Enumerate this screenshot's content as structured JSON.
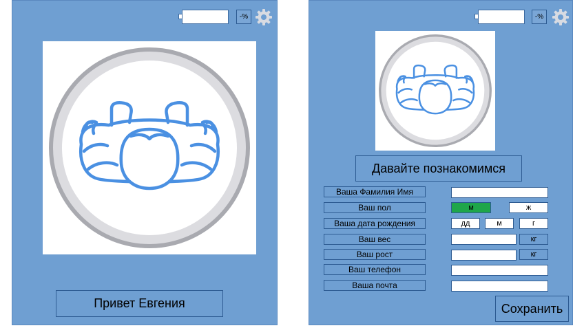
{
  "status": {
    "battery_label": "-%"
  },
  "colors": {
    "panel": "#6f9fd2",
    "accent_avatar": "#4a90e2",
    "selected": "#1fa64a"
  },
  "welcome_screen": {
    "greeting_button": "Привет Евгения"
  },
  "profile_screen": {
    "intro_button": "Давайте познакомимся",
    "fields": {
      "name": {
        "label": "Ваша Фамилия Имя",
        "value": ""
      },
      "gender": {
        "label": "Ваш пол",
        "option_male": "м",
        "option_female": "ж",
        "selected": "м"
      },
      "birth": {
        "label": "Ваша дата рождения",
        "day": "дд",
        "month": "м",
        "year": "г"
      },
      "weight": {
        "label": "Ваш вес",
        "value": "",
        "unit": "кг"
      },
      "height": {
        "label": "Ваш рост",
        "value": "",
        "unit": "кг"
      },
      "phone": {
        "label": "Ваш телефон",
        "value": ""
      },
      "email": {
        "label": "Ваша почта",
        "value": ""
      }
    },
    "save_button": "Сохранить"
  },
  "icons": {
    "settings": "gear-icon",
    "battery": "battery-icon",
    "avatar": "user-avatar-icon"
  }
}
